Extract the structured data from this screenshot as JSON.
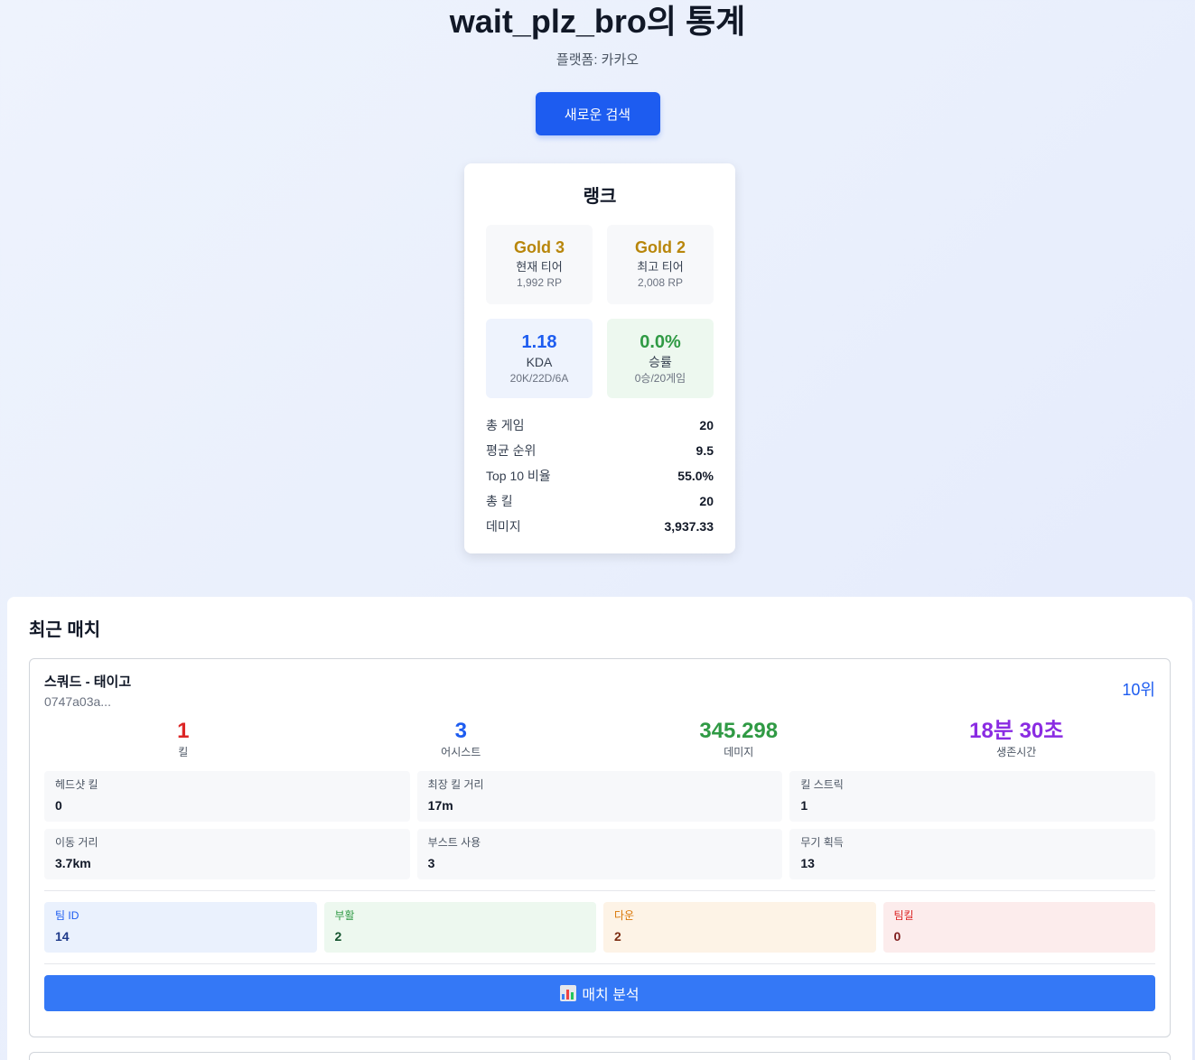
{
  "header": {
    "title": "wait_plz_bro의 통계",
    "platform": "플랫폼: 카카오",
    "new_search_label": "새로운 검색"
  },
  "rank": {
    "title": "랭크",
    "current": {
      "tier": "Gold 3",
      "label": "현재 티어",
      "rp": "1,992 RP"
    },
    "best": {
      "tier": "Gold 2",
      "label": "최고 티어",
      "rp": "2,008 RP"
    },
    "kda": {
      "value": "1.18",
      "label": "KDA",
      "sub": "20K/22D/6A"
    },
    "winrate": {
      "value": "0.0%",
      "label": "승률",
      "sub": "0승/20게임"
    },
    "summary": [
      {
        "label": "총 게임",
        "value": "20"
      },
      {
        "label": "평균 순위",
        "value": "9.5"
      },
      {
        "label": "Top 10 비율",
        "value": "55.0%"
      },
      {
        "label": "총 킬",
        "value": "20"
      },
      {
        "label": "데미지",
        "value": "3,937.33"
      }
    ]
  },
  "matches": {
    "title": "최근 매치",
    "items": [
      {
        "mode": "스쿼드 - 태이고",
        "id": "0747a03a...",
        "rank": "10위",
        "big": [
          {
            "value": "1",
            "label": "킬"
          },
          {
            "value": "3",
            "label": "어시스트"
          },
          {
            "value": "345.298",
            "label": "데미지"
          },
          {
            "value": "18분 30초",
            "label": "생존시간"
          }
        ],
        "details": [
          {
            "label": "헤드샷 킬",
            "value": "0"
          },
          {
            "label": "최장 킬 거리",
            "value": "17m"
          },
          {
            "label": "킬 스트릭",
            "value": "1"
          },
          {
            "label": "이동 거리",
            "value": "3.7km"
          },
          {
            "label": "부스트 사용",
            "value": "3"
          },
          {
            "label": "무기 획득",
            "value": "13"
          }
        ],
        "team": [
          {
            "label": "팀 ID",
            "value": "14"
          },
          {
            "label": "부활",
            "value": "2"
          },
          {
            "label": "다운",
            "value": "2"
          },
          {
            "label": "팀킬",
            "value": "0"
          }
        ],
        "analyze_label": "매치 분석",
        "analyze_icon": "bar-chart-icon"
      }
    ]
  },
  "colors": {
    "accent": "#1d5cf0",
    "gold": "#b8860b",
    "kill": "#dc2626",
    "damage": "#2f9a44",
    "survival": "#8a2be2"
  }
}
